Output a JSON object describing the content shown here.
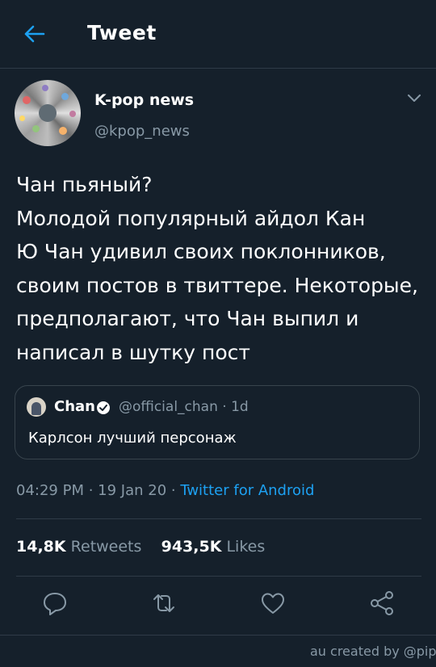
{
  "header": {
    "title": "Tweet",
    "back_icon": "arrow-left-icon"
  },
  "author": {
    "name": "K-pop news",
    "handle": "@kpop_news"
  },
  "tweet": {
    "text": "Чан пьяный?\nМолодой популярный айдол Кан\nЮ Чан удивил своих поклонников,\nсвоим постов в твиттере. Некоторые,\nпредполагают, что Чан выпил и\nнаписал в шутку пост"
  },
  "quoted_tweet": {
    "name": "Chan",
    "meta": "@official_chan · 1d",
    "text": "Карлсон лучший персонаж"
  },
  "timestamp": {
    "time": "04:29 PM · 19 Jan 20 · ",
    "source": "Twitter for Android"
  },
  "stats": {
    "retweets_count": "14,8K",
    "retweets_label": "Retweets",
    "likes_count": "943,5K",
    "likes_label": "Likes"
  },
  "actions": [
    "reply-icon",
    "retweet-icon",
    "like-icon",
    "share-icon"
  ],
  "watermark": "au created by @pip",
  "colors": {
    "background": "#15202b",
    "accent": "#1da1f2",
    "muted": "#8899a6",
    "border": "#38444d"
  }
}
